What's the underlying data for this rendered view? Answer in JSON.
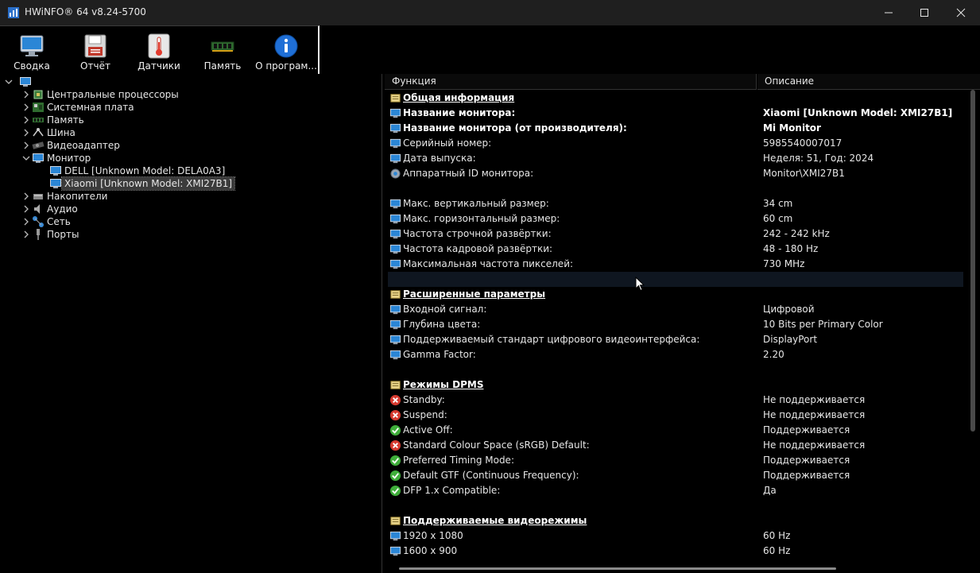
{
  "window": {
    "title": "HWiNFO® 64 v8.24-5700"
  },
  "toolbar": [
    {
      "label": "Сводка",
      "icon": "summary-monitor-icon"
    },
    {
      "label": "Отчёт",
      "icon": "report-floppy-icon"
    },
    {
      "label": "Датчики",
      "icon": "sensors-thermometer-icon"
    },
    {
      "label": "Память",
      "icon": "memory-module-icon"
    },
    {
      "label": "О програм...",
      "icon": "about-info-icon"
    }
  ],
  "tree": [
    {
      "label": "",
      "icon": "computer-icon",
      "level": 0,
      "expanded": true
    },
    {
      "label": "Центральные процессоры",
      "icon": "cpu-icon",
      "level": 1
    },
    {
      "label": "Системная плата",
      "icon": "motherboard-icon",
      "level": 1
    },
    {
      "label": "Память",
      "icon": "memory-icon",
      "level": 1
    },
    {
      "label": "Шина",
      "icon": "bus-icon",
      "level": 1
    },
    {
      "label": "Видеоадаптер",
      "icon": "gpu-icon",
      "level": 1
    },
    {
      "label": "Монитор",
      "icon": "monitor-icon",
      "level": 1,
      "expanded": true
    },
    {
      "label": "DELL [Unknown Model: DELA0A3]",
      "icon": "monitor-icon",
      "level": 2
    },
    {
      "label": "Xiaomi [Unknown Model: XMI27B1]",
      "icon": "monitor-icon",
      "level": 2,
      "selected": true
    },
    {
      "label": "Накопители",
      "icon": "drives-icon",
      "level": 1
    },
    {
      "label": "Аудио",
      "icon": "audio-icon",
      "level": 1
    },
    {
      "label": "Сеть",
      "icon": "network-icon",
      "level": 1
    },
    {
      "label": "Порты",
      "icon": "ports-icon",
      "level": 1
    }
  ],
  "columns": {
    "function": "Функция",
    "description": "Описание"
  },
  "rows": [
    {
      "type": "section",
      "fn": "Общая информация",
      "icon": "section-icon"
    },
    {
      "type": "bold",
      "fn": "Название монитора:",
      "val": "Xiaomi [Unknown Model: XMI27B1]",
      "icon": "monitor-icon"
    },
    {
      "type": "bold",
      "fn": "Название монитора (от производителя):",
      "val": "Mi Monitor",
      "icon": "monitor-icon"
    },
    {
      "type": "item",
      "fn": "Серийный номер:",
      "val": "5985540007017",
      "icon": "monitor-icon"
    },
    {
      "type": "item",
      "fn": "Дата выпуска:",
      "val": "Неделя: 51, Год: 2024",
      "icon": "monitor-icon"
    },
    {
      "type": "item",
      "fn": "Аппаратный ID монитора:",
      "val": "Monitor\\XMI27B1",
      "icon": "gear-icon"
    },
    {
      "type": "blank"
    },
    {
      "type": "item",
      "fn": "Макс. вертикальный размер:",
      "val": "34 cm",
      "icon": "monitor-icon"
    },
    {
      "type": "item",
      "fn": "Макс. горизонтальный размер:",
      "val": "60 cm",
      "icon": "monitor-icon"
    },
    {
      "type": "item",
      "fn": "Частота строчной развёртки:",
      "val": "242 - 242 kHz",
      "icon": "monitor-icon"
    },
    {
      "type": "item",
      "fn": "Частота кадровой развёртки:",
      "val": "48 - 180 Hz",
      "icon": "monitor-icon"
    },
    {
      "type": "item",
      "fn": "Максимальная частота пикселей:",
      "val": "730 MHz",
      "icon": "monitor-icon"
    },
    {
      "type": "blank",
      "highlight": true
    },
    {
      "type": "section",
      "fn": "Расширенные параметры",
      "icon": "section-icon"
    },
    {
      "type": "item",
      "fn": "Входной сигнал:",
      "val": "Цифровой",
      "icon": "monitor-icon"
    },
    {
      "type": "item",
      "fn": "Глубина цвета:",
      "val": "10 Bits per Primary Color",
      "icon": "monitor-icon"
    },
    {
      "type": "item",
      "fn": "Поддерживаемый стандарт цифрового видеоинтерфейса:",
      "val": "DisplayPort",
      "icon": "monitor-icon"
    },
    {
      "type": "item",
      "fn": "Gamma Factor:",
      "val": "2.20",
      "icon": "monitor-icon"
    },
    {
      "type": "blank"
    },
    {
      "type": "section",
      "fn": "Режимы DPMS",
      "icon": "section-icon"
    },
    {
      "type": "item",
      "fn": "Standby:",
      "val": "Не поддерживается",
      "icon": "error-icon"
    },
    {
      "type": "item",
      "fn": "Suspend:",
      "val": "Не поддерживается",
      "icon": "error-icon"
    },
    {
      "type": "item",
      "fn": "Active Off:",
      "val": "Поддерживается",
      "icon": "check-icon"
    },
    {
      "type": "item",
      "fn": "Standard Colour Space (sRGB) Default:",
      "val": "Не поддерживается",
      "icon": "error-icon"
    },
    {
      "type": "item",
      "fn": "Preferred Timing Mode:",
      "val": "Поддерживается",
      "icon": "check-icon"
    },
    {
      "type": "item",
      "fn": "Default GTF (Continuous Frequency):",
      "val": "Поддерживается",
      "icon": "check-icon"
    },
    {
      "type": "item",
      "fn": "DFP 1.x Compatible:",
      "val": "Да",
      "icon": "check-icon"
    },
    {
      "type": "blank"
    },
    {
      "type": "section",
      "fn": "Поддерживаемые видеорежимы",
      "icon": "section-icon"
    },
    {
      "type": "item",
      "fn": "1920 x 1080",
      "val": "60 Hz",
      "icon": "monitor-icon"
    },
    {
      "type": "item",
      "fn": "1600 x 900",
      "val": "60 Hz",
      "icon": "monitor-icon"
    }
  ]
}
